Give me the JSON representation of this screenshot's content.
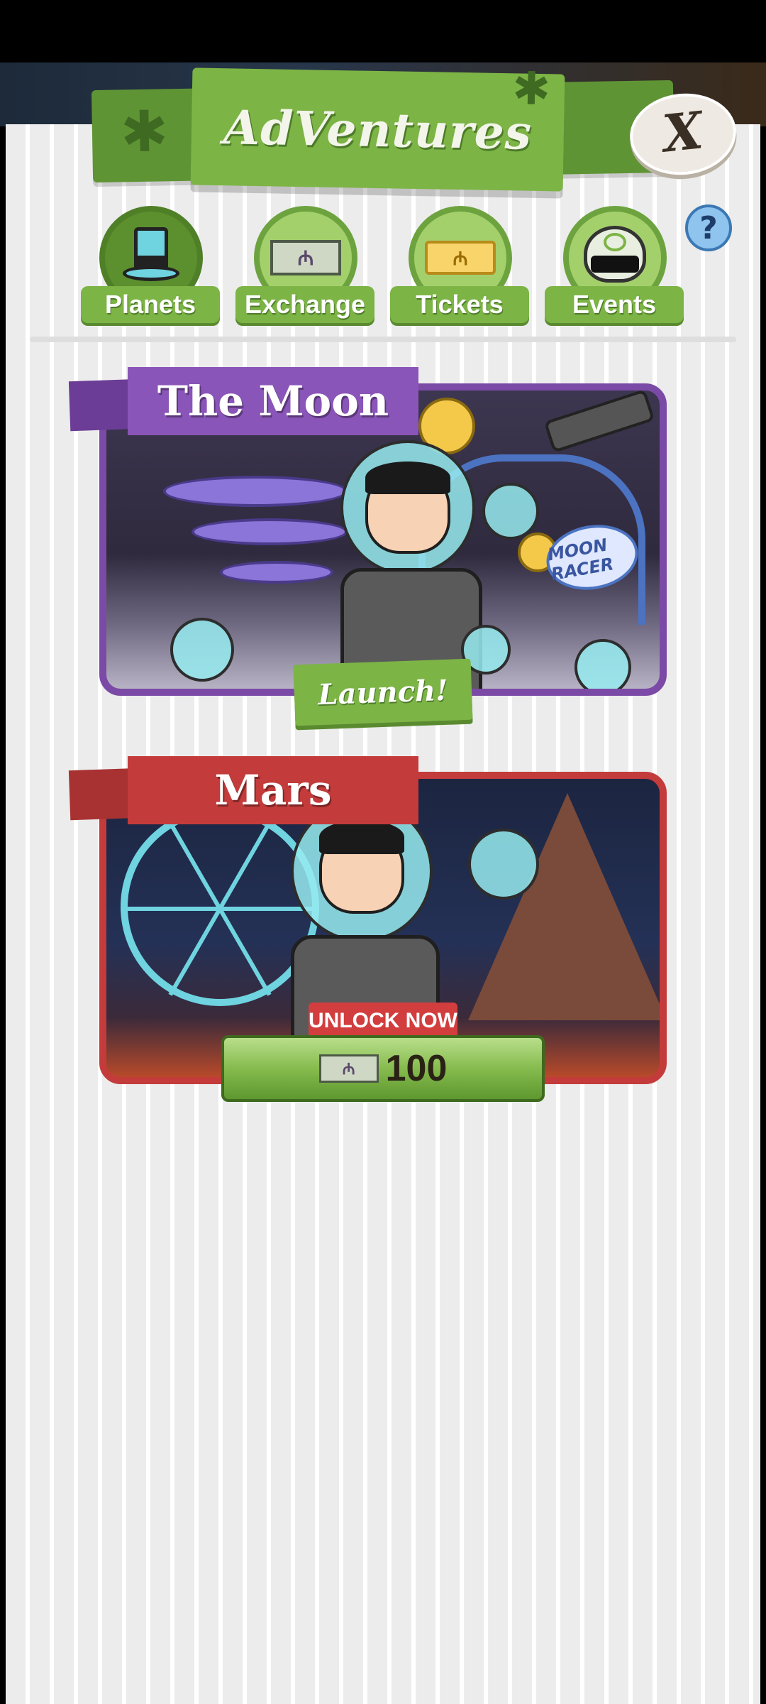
{
  "header": {
    "title": "AdVentures",
    "close_label": "X",
    "help_label": "?"
  },
  "tabs": [
    {
      "label": "Planets",
      "icon": "top-hat-icon"
    },
    {
      "label": "Exchange",
      "icon": "megabucks-bill-icon",
      "icon_text": "₼"
    },
    {
      "label": "Tickets",
      "icon": "ticket-icon",
      "icon_text": "₼"
    },
    {
      "label": "Events",
      "icon": "football-helmet-icon"
    }
  ],
  "planets": [
    {
      "name": "The Moon",
      "action": "Launch!",
      "sign_text": "MOON RACER",
      "color": "#7b4aa6"
    },
    {
      "name": "Mars",
      "unlock_label": "UNLOCK NOW",
      "currency_symbol": "₼",
      "price": "100",
      "color": "#c43b3b"
    }
  ]
}
